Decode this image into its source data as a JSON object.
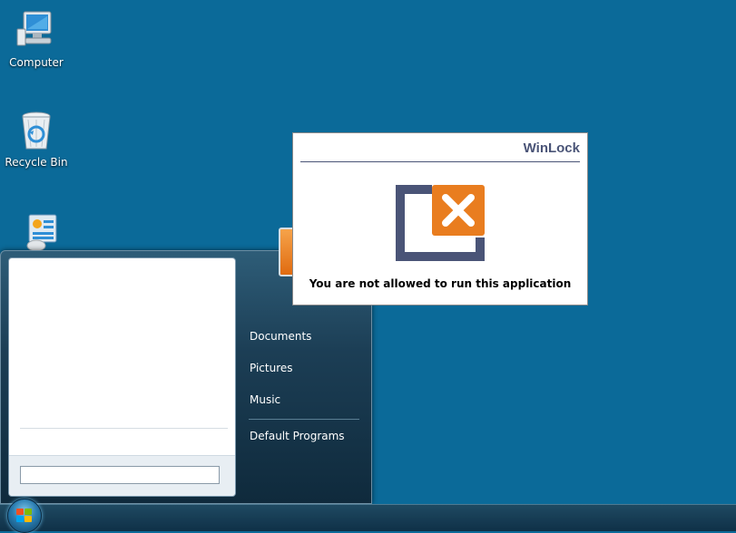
{
  "desktop": {
    "icons": [
      {
        "label": "Computer"
      },
      {
        "label": "Recycle Bin"
      },
      {
        "label": ""
      }
    ]
  },
  "start_menu": {
    "search": {
      "value": "",
      "placeholder": ""
    },
    "right_items": [
      {
        "label": "Documents"
      },
      {
        "label": "Pictures"
      },
      {
        "label": "Music"
      },
      {
        "label": "Default Programs"
      }
    ]
  },
  "dialog": {
    "title": "WinLock",
    "message": "You are not allowed to run this application",
    "icon": "blocked-window-icon",
    "colors": {
      "title": "#4a5477",
      "frame": "#4a5477",
      "badge": "#e97d1f"
    }
  },
  "taskbar": {
    "start_icon": "windows-orb-icon"
  }
}
